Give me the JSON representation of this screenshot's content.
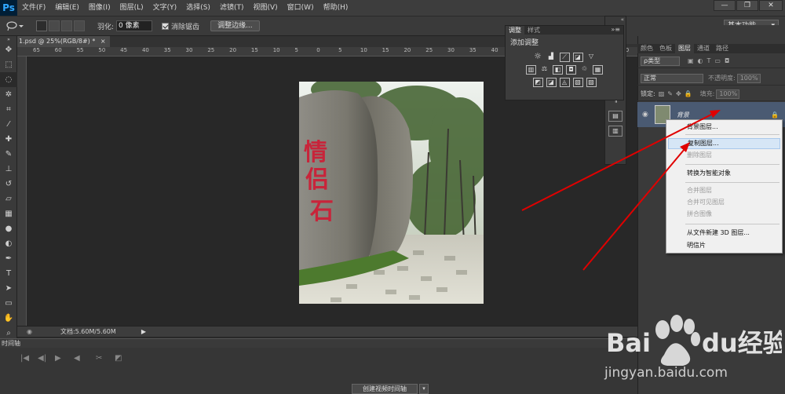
{
  "app": {
    "logo": "Ps"
  },
  "menu": {
    "items": [
      "文件(F)",
      "编辑(E)",
      "图像(I)",
      "图层(L)",
      "文字(Y)",
      "选择(S)",
      "滤镜(T)",
      "视图(V)",
      "窗口(W)",
      "帮助(H)"
    ]
  },
  "window_controls": {
    "minimize": "—",
    "restore": "❐",
    "close": "✕"
  },
  "options_bar": {
    "feather_label": "羽化:",
    "feather_value": "0 像素",
    "antialias_label": "消除锯齿",
    "refine_edge_label": "调整边缘...",
    "workspace_label": "基本功能"
  },
  "document": {
    "tab_title": "1.psd @ 25%(RGB/8#) *",
    "status_text": "文档:5.60M/5.60M"
  },
  "ruler_top_labels": [
    "65",
    "60",
    "55",
    "50",
    "45",
    "40",
    "35",
    "30",
    "25",
    "20",
    "15",
    "10",
    "5",
    "0",
    "5",
    "10",
    "15",
    "20",
    "25",
    "30",
    "35",
    "40",
    "45",
    "50",
    "55",
    "60",
    "65",
    "70"
  ],
  "adjust_panel": {
    "tabs": [
      "调整",
      "样式"
    ],
    "title": "添加调整"
  },
  "layers_panel": {
    "tabs": [
      "颜色",
      "色板",
      "图层",
      "通道",
      "路径"
    ],
    "kind_label": "ρ类型",
    "blend_mode": "正常",
    "opacity_label": "不透明度:",
    "opacity_value": "100%",
    "lock_label": "锁定:",
    "fill_label": "填充:",
    "fill_value": "100%",
    "layer_name": "背景"
  },
  "context_menu": {
    "items": [
      {
        "label": "背景图层...",
        "disabled": false
      },
      {
        "label": "复制图层...",
        "disabled": false,
        "hover": true
      },
      {
        "label": "删除图层",
        "disabled": true
      },
      {
        "label": "转换为智能对象",
        "disabled": false
      },
      {
        "label": "合并图层",
        "disabled": true
      },
      {
        "label": "合并可见图层",
        "disabled": true
      },
      {
        "label": "拼合图像",
        "disabled": true
      },
      {
        "label": "从文件新建 3D 图层...",
        "disabled": false
      },
      {
        "label": "明信片",
        "disabled": false
      }
    ]
  },
  "timeline": {
    "header": "时间轴",
    "create_button": "创建视频时间轴"
  },
  "photo": {
    "carved_text": [
      "情",
      "侣",
      "石"
    ]
  },
  "watermark": {
    "brand": "Baidu经验",
    "url": "jingyan.baidu.com"
  },
  "colors": {
    "arrow": "#e00000",
    "ui_dark": "#3a3a3a",
    "canvas_bg": "#282828"
  }
}
